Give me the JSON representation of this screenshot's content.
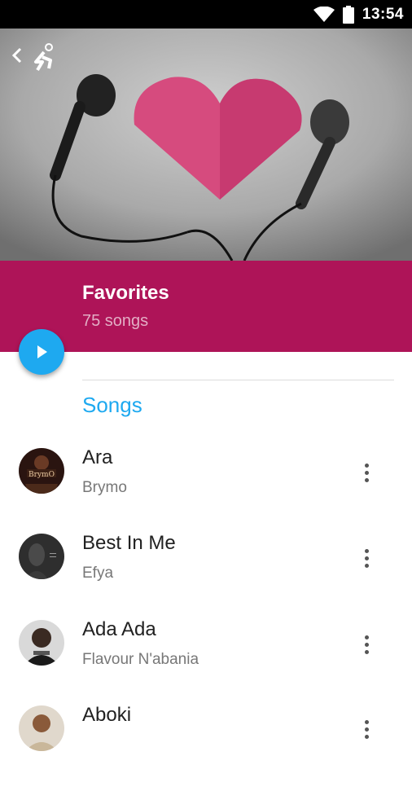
{
  "status_bar": {
    "time": "13:54"
  },
  "header": {
    "back_icon": "chevron-left-icon",
    "logo_icon": "running-figure-icon"
  },
  "playlist": {
    "title": "Favorites",
    "count": "75 songs",
    "accent_color": "#ae1458",
    "play_icon": "play-icon"
  },
  "section": {
    "title": "Songs"
  },
  "songs": [
    {
      "title": "Ara",
      "artist": "Brymo"
    },
    {
      "title": "Best In Me",
      "artist": "Efya"
    },
    {
      "title": "Ada Ada",
      "artist": "Flavour N'abania"
    },
    {
      "title": "Aboki",
      "artist": ""
    }
  ],
  "colors": {
    "banner": "#ae1458",
    "fab": "#1ea9f0",
    "section_title": "#1ea9f0"
  }
}
